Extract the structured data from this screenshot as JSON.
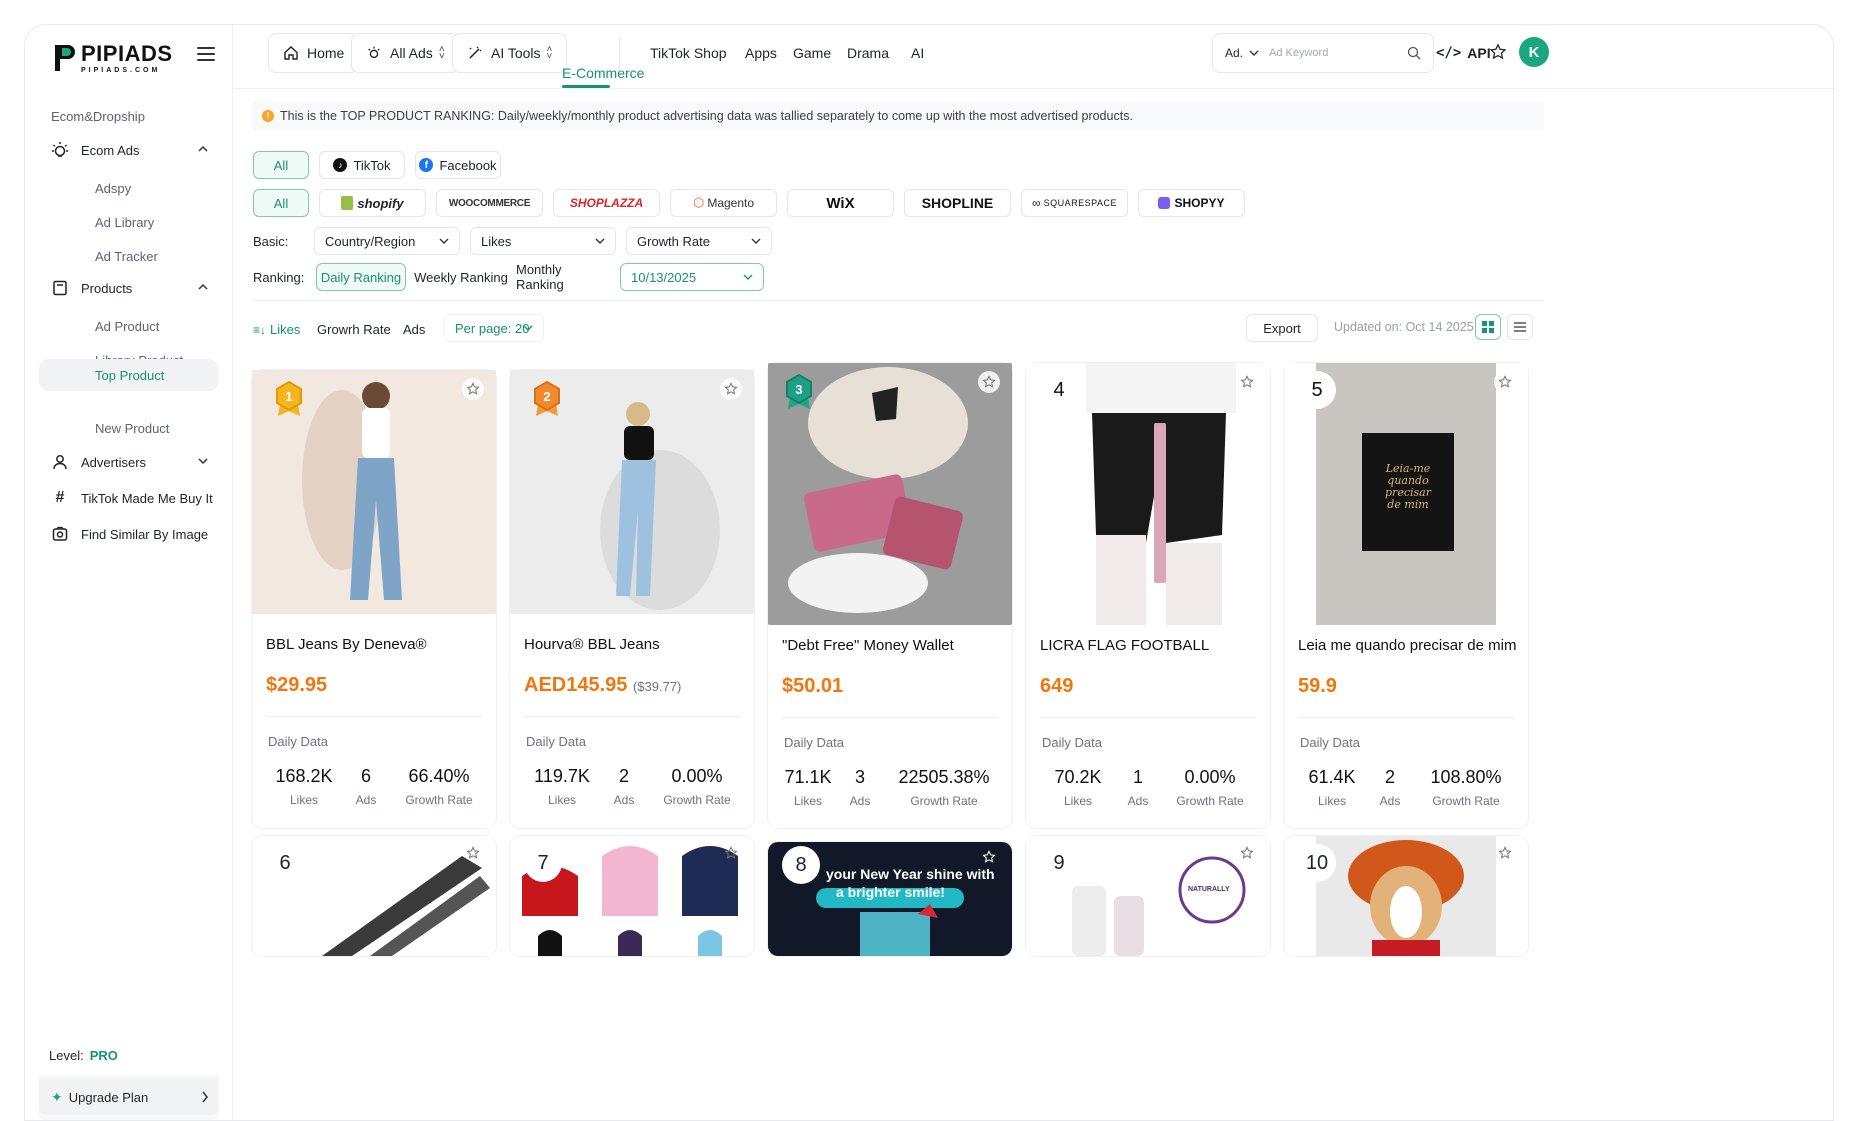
{
  "brand": {
    "name": "PIPIADS",
    "domain": "PIPIADS.COM",
    "accent": "#16936f",
    "price_color": "#f0760e"
  },
  "sidebar": {
    "section_label": "Ecom&Dropship",
    "groups": [
      {
        "label": "Ecom Ads",
        "icon": "bulb-icon",
        "items": [
          "Adspy",
          "Ad Library",
          "Ad Tracker"
        ]
      },
      {
        "label": "Products",
        "icon": "box-icon",
        "items": [
          "Ad Product",
          "Library Product",
          "Top Product",
          "New Product"
        ]
      }
    ],
    "advertisers": "Advertisers",
    "tiktok_made": "TikTok Made Me Buy It",
    "find_similar": "Find Similar By Image",
    "active_item": "Top Product",
    "level_label": "Level:",
    "level_value": "PRO",
    "upgrade_label": "Upgrade Plan"
  },
  "topbar": {
    "home": "Home",
    "all_ads": "All Ads",
    "ai_tools": "AI Tools",
    "tabs": [
      "E-Commerce",
      "TikTok Shop",
      "Apps",
      "Game",
      "Drama",
      "AI"
    ],
    "active_tab": "E-Commerce",
    "search_select": "Ad.",
    "search_placeholder": "Ad Keyword",
    "api": "API",
    "avatar": "K"
  },
  "notice": "This is the TOP PRODUCT RANKING: Daily/weekly/monthly product advertising data was tallied separately to come up with the most advertised products.",
  "filters": {
    "channels": [
      "All",
      "TikTok",
      "Facebook"
    ],
    "platforms_all": "All",
    "platforms": [
      "shopify",
      "WOOCOMMERCE",
      "SHOPLAZZA",
      "Magento",
      "WiX",
      "SHOPLINE",
      "SQUARESPACE",
      "SHOPYY"
    ],
    "basic_label": "Basic:",
    "basic": [
      "Country/Region",
      "Likes",
      "Growth Rate"
    ],
    "ranking_label": "Ranking:",
    "ranking": [
      "Daily Ranking",
      "Weekly Ranking",
      "Monthly Ranking"
    ],
    "ranking_active": "Daily Ranking",
    "date": "10/13/2025"
  },
  "sortbar": {
    "likes": "Likes",
    "growth": "Growrh Rate",
    "ads": "Ads",
    "per_page": "Per page: 20",
    "export": "Export",
    "updated": "Updated on: Oct 14 2025"
  },
  "cards": [
    {
      "rank": "1",
      "title": "BBL Jeans By Deneva®",
      "price": "$29.95",
      "price_sub": "",
      "daily": "Daily Data",
      "likes": "168.2K",
      "ads": "6",
      "growth": "66.40%"
    },
    {
      "rank": "2",
      "title": "Hourva® BBL Jeans",
      "price": "AED145.95",
      "price_sub": "($39.77)",
      "daily": "Daily Data",
      "likes": "119.7K",
      "ads": "2",
      "growth": "0.00%"
    },
    {
      "rank": "3",
      "title": "\"Debt Free\" Money Wallet",
      "price": "$50.01",
      "price_sub": "",
      "daily": "Daily Data",
      "likes": "71.1K",
      "ads": "3",
      "growth": "22505.38%"
    },
    {
      "rank": "4",
      "title": "LICRA FLAG FOOTBALL",
      "price": "649",
      "price_sub": "",
      "daily": "Daily Data",
      "likes": "70.2K",
      "ads": "1",
      "growth": "0.00%"
    },
    {
      "rank": "5",
      "title": "Leia me quando precisar de mim",
      "price": "59.9",
      "price_sub": "",
      "daily": "Daily Data",
      "likes": "61.4K",
      "ads": "2",
      "growth": "108.80%"
    }
  ],
  "stat_labels": {
    "likes": "Likes",
    "ads": "Ads",
    "growth": "Growth Rate"
  },
  "row2": [
    {
      "rank": "6"
    },
    {
      "rank": "7"
    },
    {
      "rank": "8",
      "banner_line1": "your New Year shine with",
      "banner_line2": "a brighter smile!"
    },
    {
      "rank": "9",
      "badge": "NATURALLY"
    },
    {
      "rank": "10"
    }
  ],
  "book_text": "Leia-me quando precisar de mim"
}
